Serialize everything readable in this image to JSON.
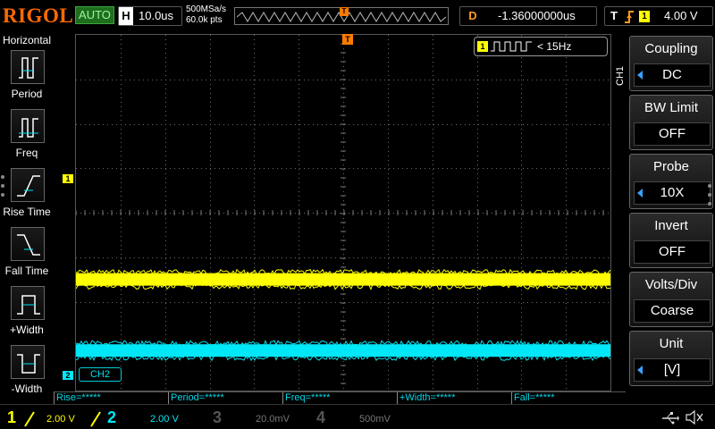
{
  "topbar": {
    "brand": "RIGOL",
    "run_state": "AUTO",
    "timebase_key": "H",
    "timebase": "10.0us",
    "sample_rate": "500MSa/s",
    "memory_depth": "60.0k pts",
    "trigger_marker": "T",
    "delay_key": "D",
    "delay": "-1.36000000us",
    "trigger_key": "T",
    "trigger_source": "1",
    "trigger_level": "4.00 V"
  },
  "left_menu": {
    "title": "Horizontal",
    "items": [
      {
        "label": "Period",
        "icon": "period-icon"
      },
      {
        "label": "Freq",
        "icon": "freq-icon"
      },
      {
        "label": "Rise Time",
        "icon": "rise-time-icon"
      },
      {
        "label": "Fall Time",
        "icon": "fall-time-icon"
      },
      {
        "label": "+Width",
        "icon": "pos-width-icon"
      },
      {
        "label": "-Width",
        "icon": "neg-width-icon"
      }
    ]
  },
  "screen": {
    "ch1_marker": "1",
    "ch2_marker": "2",
    "ch2_tag": "CH2",
    "freq_channel": "1",
    "freq_value": "< 15Hz",
    "trigger_marker": "T",
    "ch1_color": "#ffff00",
    "ch2_color": "#00e8f8",
    "trace_levels": {
      "ch1": 2.5,
      "ch2": 0.9
    }
  },
  "right_menu": {
    "channel_label": "CH1",
    "items": [
      {
        "title": "Coupling",
        "value": "DC"
      },
      {
        "title": "BW Limit",
        "value": "OFF"
      },
      {
        "title": "Probe",
        "value": "10X"
      },
      {
        "title": "Invert",
        "value": "OFF"
      },
      {
        "title": "Volts/Div",
        "value": "Coarse"
      },
      {
        "title": "Unit",
        "value": "[V]"
      }
    ]
  },
  "measurements": [
    {
      "label": "Rise=*****"
    },
    {
      "label": "Period=*****"
    },
    {
      "label": "Freq=*****"
    },
    {
      "label": "+Width=*****"
    },
    {
      "label": "Fall=*****"
    }
  ],
  "bottombar": {
    "channels": [
      {
        "num": "1",
        "scale": "2.00 V",
        "color": "#ffff00"
      },
      {
        "num": "2",
        "scale": "2.00 V",
        "color": "#00e8f8"
      },
      {
        "num": "3",
        "scale": "20.0mV",
        "color": "#666666"
      },
      {
        "num": "4",
        "scale": "500mV",
        "color": "#666666"
      }
    ],
    "usb_icon": "usb-icon",
    "speaker_icon": "speaker-mute-icon"
  }
}
